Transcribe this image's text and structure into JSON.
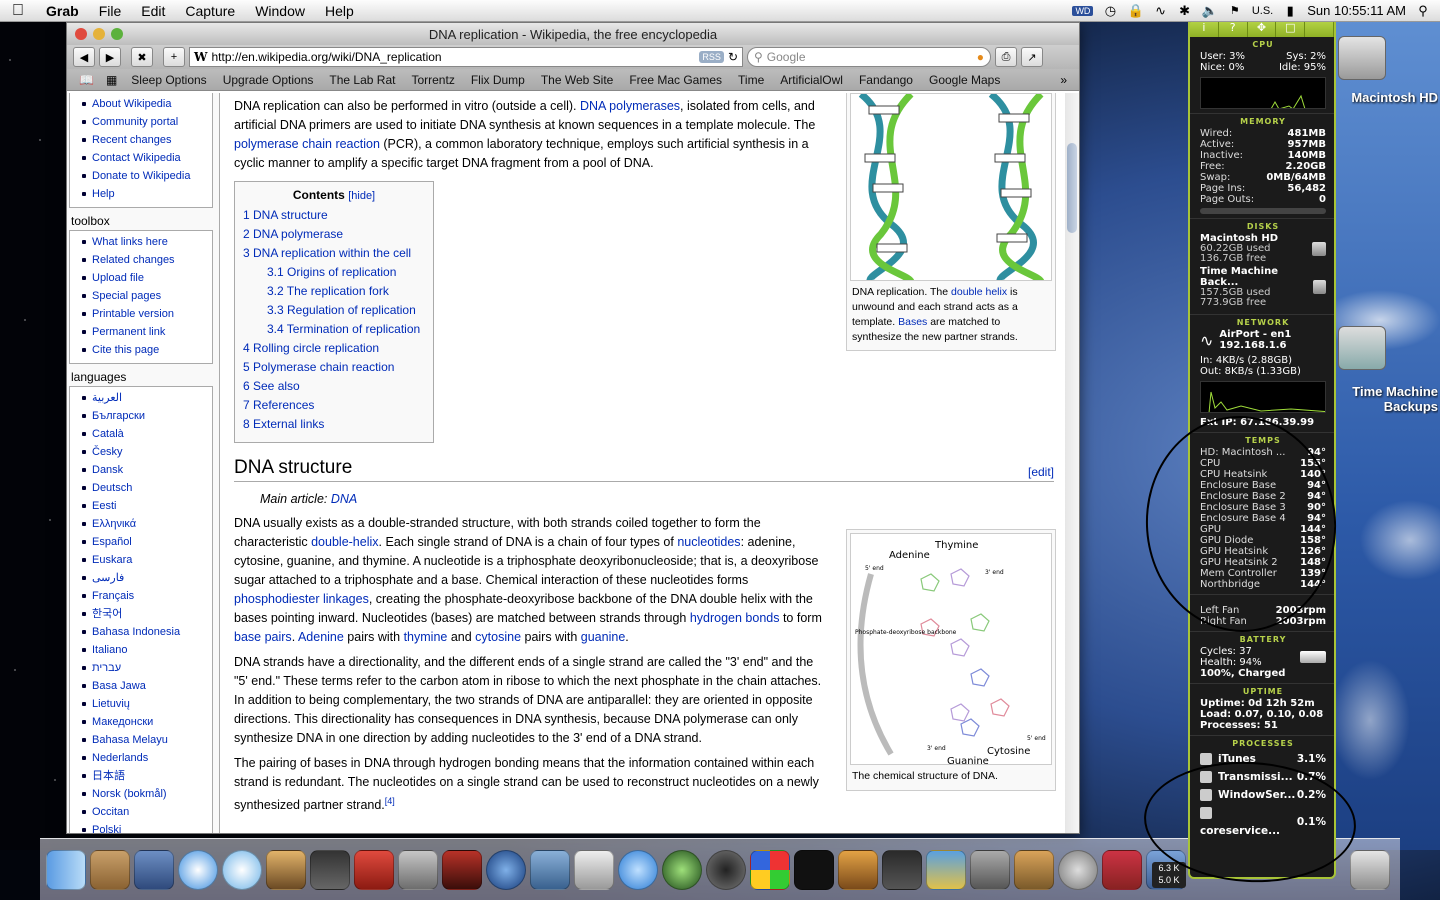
{
  "menubar": {
    "app": "Grab",
    "menus": [
      "File",
      "Edit",
      "Capture",
      "Window",
      "Help"
    ],
    "input_locale": "U.S.",
    "clock": "Sun 10:55:11 AM"
  },
  "browser": {
    "title": "DNA replication - Wikipedia, the free encyclopedia",
    "url": "http://en.wikipedia.org/wiki/DNA_replication",
    "rss": "RSS",
    "search_placeholder": "Google",
    "bookmarks": [
      "Sleep Options",
      "Upgrade Options",
      "The Lab Rat",
      "Torrentz",
      "Flix Dump",
      "The Web Site",
      "Free Mac Games",
      "Time",
      "ArtificialOwl",
      "Fandango",
      "Google Maps"
    ]
  },
  "sidebar": {
    "interaction": [
      "About Wikipedia",
      "Community portal",
      "Recent changes",
      "Contact Wikipedia",
      "Donate to Wikipedia",
      "Help"
    ],
    "toolbox_title": "toolbox",
    "toolbox": [
      "What links here",
      "Related changes",
      "Upload file",
      "Special pages",
      "Printable version",
      "Permanent link",
      "Cite this page"
    ],
    "languages_title": "languages",
    "languages": [
      "العربية",
      "Български",
      "Català",
      "Česky",
      "Dansk",
      "Deutsch",
      "Eesti",
      "Ελληνικά",
      "Español",
      "Euskara",
      "فارسی",
      "Français",
      "한국어",
      "Bahasa Indonesia",
      "Italiano",
      "עברית",
      "Basa Jawa",
      "Lietuvių",
      "Македонски",
      "Bahasa Melayu",
      "Nederlands",
      "日本語",
      "Norsk (bokmål)",
      "Occitan",
      "Polski"
    ]
  },
  "article": {
    "intro": {
      "t1": "DNA replication can also be performed in vitro (outside a cell). ",
      "l1": "DNA polymerases",
      "t2": ", isolated from cells, and artificial DNA primers are used to initiate DNA synthesis at known sequences in a template molecule. The ",
      "l2": "polymerase chain reaction",
      "t3": " (PCR), a common laboratory technique, employs such artificial synthesis in a cyclic manner to amplify a specific target DNA fragment from a pool of DNA."
    },
    "toc_title": "Contents",
    "toc_hide": "[hide]",
    "toc": [
      {
        "label": "1 DNA structure",
        "sub": false
      },
      {
        "label": "2 DNA polymerase",
        "sub": false
      },
      {
        "label": "3 DNA replication within the cell",
        "sub": false
      },
      {
        "label": "3.1 Origins of replication",
        "sub": true
      },
      {
        "label": "3.2 The replication fork",
        "sub": true
      },
      {
        "label": "3.3 Regulation of replication",
        "sub": true
      },
      {
        "label": "3.4 Termination of replication",
        "sub": true
      },
      {
        "label": "4 Rolling circle replication",
        "sub": false
      },
      {
        "label": "5 Polymerase chain reaction",
        "sub": false
      },
      {
        "label": "6 See also",
        "sub": false
      },
      {
        "label": "7 References",
        "sub": false
      },
      {
        "label": "8 External links",
        "sub": false
      }
    ],
    "section_title": "DNA structure",
    "edit": "[edit]",
    "main_article_prefix": "Main article: ",
    "main_article_link": "DNA",
    "p1": {
      "t1": "DNA usually exists as a double-stranded structure, with both strands coiled together to form the characteristic ",
      "l1": "double-helix",
      "t2": ". Each single strand of DNA is a chain of four types of ",
      "l2": "nucleotides",
      "t3": ": adenine, cytosine, guanine, and thymine. A nucleotide is a triphosphate deoxyribonucleoside; that is, a deoxyribose sugar attached to a triphosphate and a base. Chemical interaction of these nucleotides forms ",
      "l3": "phosphodiester linkages",
      "t4": ", creating the phosphate-deoxyribose backbone of the DNA double helix with the bases pointing inward. Nucleotides (bases) are matched between strands through ",
      "l4": "hydrogen bonds",
      "t5": " to form ",
      "l5": "base pairs",
      "t6": ". ",
      "l6": "Adenine",
      "t7": " pairs with ",
      "l7": "thymine",
      "t8": " and ",
      "l8": "cytosine",
      "t9": " pairs with ",
      "l9": "guanine",
      "t10": "."
    },
    "p2": "DNA strands have a directionality, and the different ends of a single strand are called the \"3' end\" and the \"5' end.\" These terms refer to the carbon atom in ribose to which the next phosphate in the chain attaches. In addition to being complementary, the two strands of DNA are antiparallel: they are oriented in opposite directions. This directionality has consequences in DNA synthesis, because DNA polymerase can only synthesize DNA in one direction by adding nucleotides to the 3' end of a DNA strand.",
    "p3": "The pairing of bases in DNA through hydrogen bonding means that the information contained within each strand is redundant. The nucleotides on a single strand can be used to reconstruct nucleotides on a newly synthesized partner strand.",
    "p3_ref": "[4]",
    "fig1": {
      "c1": "DNA replication. The ",
      "l1": "double helix",
      "c2": " is unwound and each strand acts as a template. ",
      "l2": "Bases",
      "c3": " are matched to synthesize the new partner strands."
    },
    "fig2": {
      "caption": "The chemical structure of DNA.",
      "labels": {
        "thymine": "Thymine",
        "adenine": "Adenine",
        "cytosine": "Cytosine",
        "guanine": "Guanine",
        "backbone": "Phosphate-deoxyribose backbone",
        "end5a": "5' end",
        "end3a": "3' end",
        "end3b": "3' end",
        "end5b": "5' end"
      }
    }
  },
  "istat": {
    "cpu": {
      "title": "CPU",
      "user": "User: 3%",
      "sys": "Sys: 2%",
      "nice": "Nice: 0%",
      "idle": "Idle: 95%"
    },
    "memory": {
      "title": "MEMORY",
      "rows": [
        [
          "Wired:",
          "481MB"
        ],
        [
          "Active:",
          "957MB"
        ],
        [
          "Inactive:",
          "140MB"
        ],
        [
          "Free:",
          "2.20GB"
        ],
        [
          "Swap:",
          "0MB/64MB"
        ],
        [
          "Page Ins:",
          "56,482"
        ],
        [
          "Page Outs:",
          "0"
        ]
      ]
    },
    "disks": {
      "title": "DISKS",
      "items": [
        {
          "name": "Macintosh HD",
          "used": "60.22GB used",
          "free": "136.7GB free"
        },
        {
          "name": "Time Machine Back...",
          "used": "157.5GB used",
          "free": "773.9GB free"
        }
      ]
    },
    "network": {
      "title": "NETWORK",
      "iface": "AirPort - en1",
      "ip": "192.168.1.6",
      "in": "In: 4KB/s (2.88GB)",
      "out": "Out: 8KB/s (1.33GB)",
      "ext": "Ext IP: 67.186.39.99"
    },
    "temps": {
      "title": "TEMPS",
      "rows": [
        [
          "HD: Macintosh ...",
          "94°"
        ],
        [
          "CPU",
          "155°"
        ],
        [
          "CPU Heatsink",
          "140°"
        ],
        [
          "Enclosure Base",
          "94°"
        ],
        [
          "Enclosure Base 2",
          "94°"
        ],
        [
          "Enclosure Base 3",
          "90°"
        ],
        [
          "Enclosure Base 4",
          "94°"
        ],
        [
          "GPU",
          "144°"
        ],
        [
          "GPU Diode",
          "158°"
        ],
        [
          "GPU Heatsink",
          "126°"
        ],
        [
          "GPU Heatsink 2",
          "148°"
        ],
        [
          "Mem Controller",
          "139°"
        ],
        [
          "Northbridge",
          "144°"
        ]
      ]
    },
    "fans": {
      "rows": [
        [
          "Left Fan",
          "2003rpm"
        ],
        [
          "Right Fan",
          "2003rpm"
        ]
      ]
    },
    "battery": {
      "title": "BATTERY",
      "cycles": "Cycles: 37",
      "health": "Health: 94%",
      "status": "100%, Charged"
    },
    "uptime": {
      "title": "UPTIME",
      "uptime": "Uptime: 0d 12h 52m",
      "load": "Load: 0.07, 0.10, 0.08",
      "processes": "Processes: 51"
    },
    "processes": {
      "title": "PROCESSES",
      "rows": [
        [
          "iTunes",
          "3.1%"
        ],
        [
          "Transmissi...",
          "0.7%"
        ],
        [
          "WindowSer...",
          "0.2%"
        ],
        [
          "coreservice...",
          "0.1%"
        ]
      ]
    }
  },
  "desktop": {
    "hd_label": "Macintosh HD",
    "tm_label_1": "Time Machine",
    "tm_label_2": "Backups"
  },
  "dock": {
    "net_up": "6.3 K",
    "net_down": "5.0 K"
  }
}
